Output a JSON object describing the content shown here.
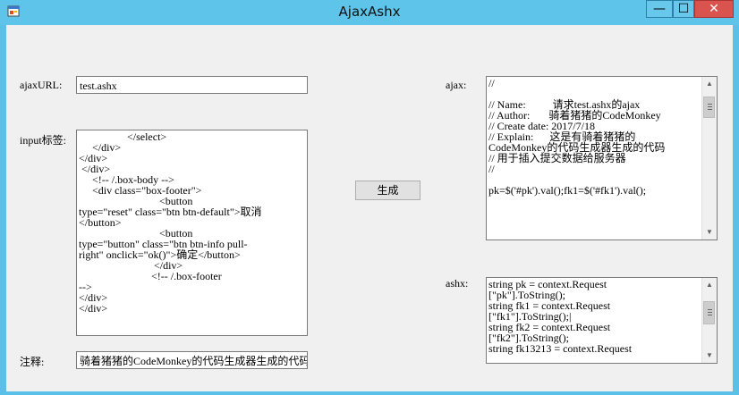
{
  "window": {
    "title": "AjaxAshx",
    "minimize_label": "—",
    "maximize_label": "☐",
    "close_label": "✕"
  },
  "form": {
    "ajaxurl_label": "ajaxURL:",
    "ajaxurl_value": "test.ashx",
    "input_label": "input标签:",
    "input_text": "                  </select>\n     </div>\n</div>\n </div>\n     <!-- /.box-body -->\n     <div class=\"box-footer\">\n                              <button\ntype=\"reset\" class=\"btn btn-default\">取消\n</button>\n                              <button\ntype=\"button\" class=\"btn btn-info pull-\nright\" onclick=\"ok()\">确定</button>\n                            </div>\n                           <!-- /.box-footer\n-->\n</div>\n</div>",
    "note_label": "注释:",
    "note_value": "骑着猪猪的CodeMonkey的代码生成器生成的代码",
    "generate_button": "生成",
    "ajax_label": "ajax:",
    "ajax_text": "//\n\n// Name:          请求test.ashx的ajax\n// Author:       骑着猪猪的CodeMonkey\n// Create date: 2017/7/18\n// Explain:      这是有骑着猪猪的\nCodeMonkey的代码生成器生成的代码\n// 用于插入提交数据给服务器\n//\n\npk=$('#pk').val();fk1=$('#fk1').val();",
    "ashx_label": "ashx:",
    "ashx_text": "string pk = context.Request\n[\"pk\"].ToString();\nstring fk1 = context.Request\n[\"fk1\"].ToString();|\nstring fk2 = context.Request\n[\"fk2\"].ToString();\nstring fk13213 = context.Request"
  },
  "icons": {
    "app": "app-form-icon",
    "scroll_up": "arrow-up-icon",
    "scroll_down": "arrow-down-icon"
  },
  "colors": {
    "titlebar": "#5ec4ea",
    "close": "#d9534f",
    "client": "#f0f0f0"
  }
}
